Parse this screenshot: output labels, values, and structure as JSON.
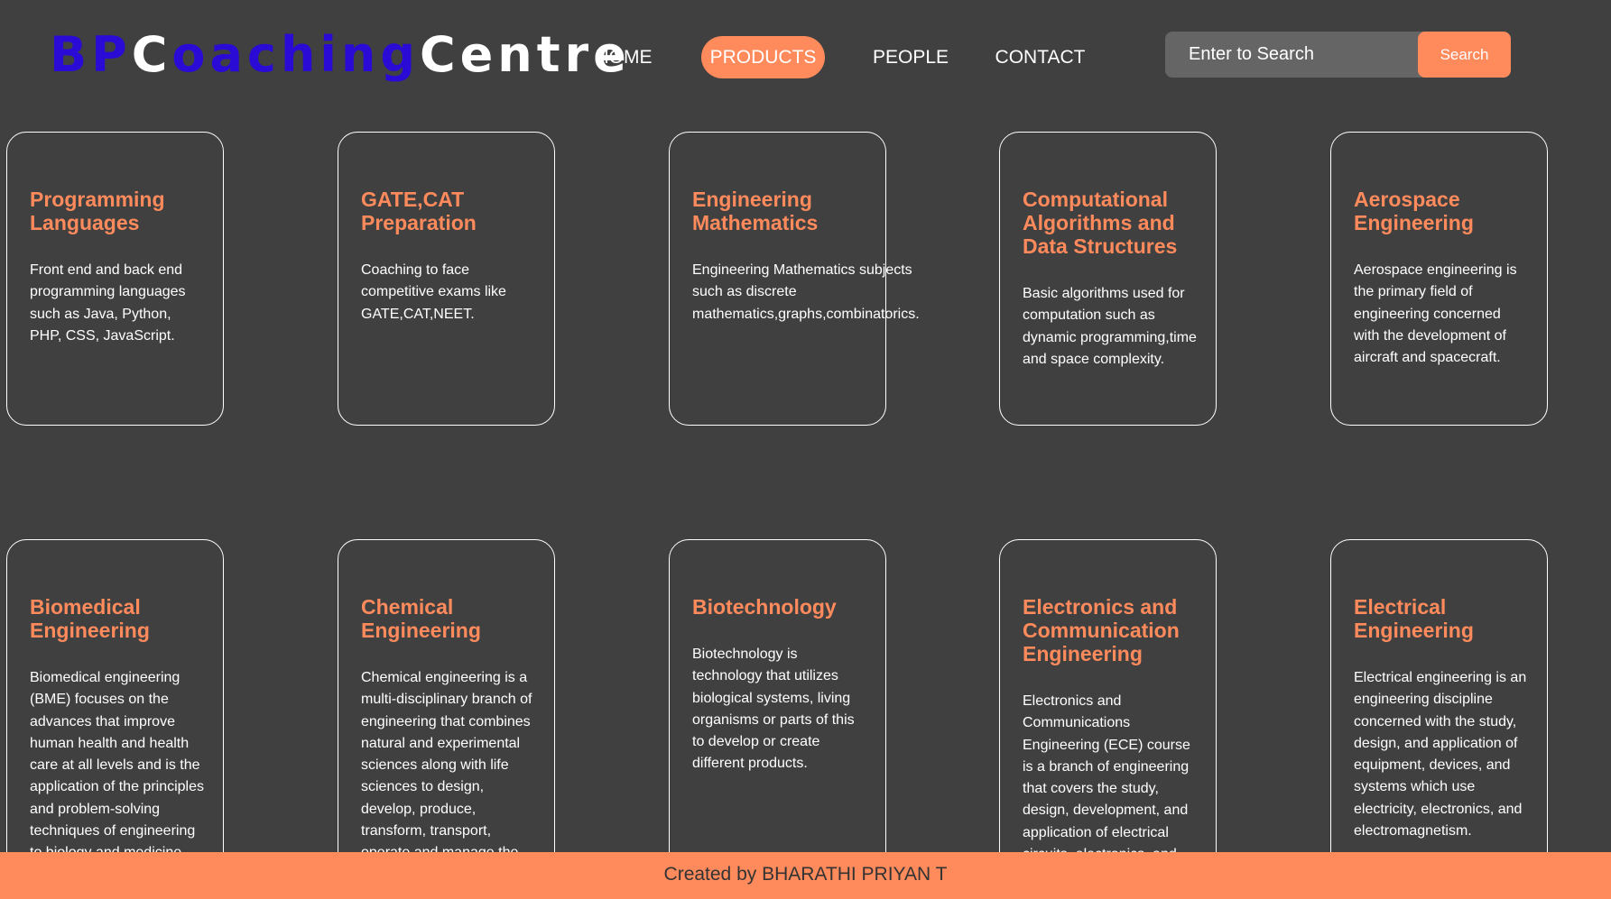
{
  "header": {
    "logo": {
      "part1": "BP",
      "part2": "C",
      "part3": "oaching",
      "part4": "Centre"
    },
    "nav": [
      {
        "label": "HOME",
        "active": false
      },
      {
        "label": "PRODUCTS",
        "active": true
      },
      {
        "label": "PEOPLE",
        "active": false
      },
      {
        "label": "CONTACT",
        "active": false
      }
    ],
    "search": {
      "placeholder": "Enter to Search",
      "button_label": "Search"
    }
  },
  "colors": {
    "accent": "#ff8a5c",
    "logo_blue": "#2a0bd6",
    "background": "#404040"
  },
  "cards": [
    {
      "title": "Programming Languages",
      "description": "Front end and back end programming languages such as Java, Python, PHP, CSS, JavaScript."
    },
    {
      "title": "GATE,CAT Preparation",
      "description": "Coaching to face competitive exams like GATE,CAT,NEET."
    },
    {
      "title": "Engineering Mathematics",
      "description": "Engineering Mathematics subjects such as discrete mathematics,graphs,combinatorics."
    },
    {
      "title": "Computational Algorithms and Data Structures",
      "description": "Basic algorithms used for computation such as dynamic programming,time and space complexity."
    },
    {
      "title": "Aerospace Engineering",
      "description": "Aerospace engineering is the primary field of engineering concerned with the development of aircraft and spacecraft."
    },
    {
      "title": "Biomedical Engineering",
      "description": "Biomedical engineering (BME) focuses on the advances that improve human health and health care at all levels and is the application of the principles and problem-solving techniques of engineering to biology and medicine."
    },
    {
      "title": "Chemical Engineering",
      "description": "Chemical engineering is a multi-disciplinary branch of engineering that combines natural and experimental sciences along with life sciences to design, develop, produce, transform, transport, operate and manage the industrial processes that turn raw materials into"
    },
    {
      "title": "Biotechnology",
      "description": "Biotechnology is technology that utilizes biological systems, living organisms or parts of this to develop or create different products."
    },
    {
      "title": "Electronics and Communication Engineering",
      "description": "Electronics and Communications Engineering (ECE) course is a branch of engineering that covers the study, design, development, and application of electrical circuits, electronics, and communication systems."
    },
    {
      "title": "Electrical Engineering",
      "description": "Electrical engineering is an engineering discipline concerned with the study, design, and application of equipment, devices, and systems which use electricity, electronics, and electromagnetism."
    }
  ],
  "footer": {
    "text": "Created by BHARATHI PRIYAN T"
  }
}
